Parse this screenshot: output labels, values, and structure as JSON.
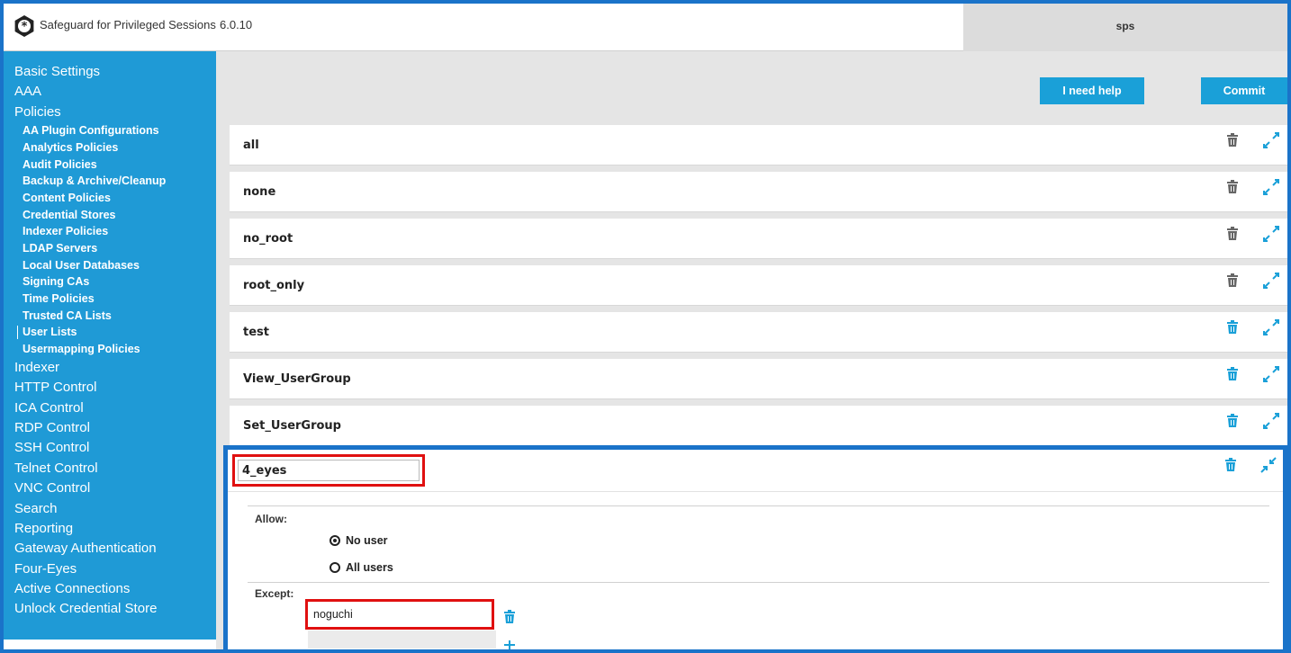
{
  "header": {
    "brand": "Safeguard for Privileged Sessions",
    "version": "6.0.10",
    "host": "sps"
  },
  "sidebar": {
    "items": [
      {
        "label": "Basic Settings",
        "level": "top"
      },
      {
        "label": "AAA",
        "level": "top"
      },
      {
        "label": "Policies",
        "level": "top"
      },
      {
        "label": "AA Plugin Configurations",
        "level": "sub"
      },
      {
        "label": "Analytics Policies",
        "level": "sub"
      },
      {
        "label": "Audit Policies",
        "level": "sub"
      },
      {
        "label": "Backup & Archive/Cleanup",
        "level": "sub"
      },
      {
        "label": "Content Policies",
        "level": "sub"
      },
      {
        "label": "Credential Stores",
        "level": "sub"
      },
      {
        "label": "Indexer Policies",
        "level": "sub"
      },
      {
        "label": "LDAP Servers",
        "level": "sub"
      },
      {
        "label": "Local User Databases",
        "level": "sub"
      },
      {
        "label": "Signing CAs",
        "level": "sub"
      },
      {
        "label": "Time Policies",
        "level": "sub"
      },
      {
        "label": "Trusted CA Lists",
        "level": "sub"
      },
      {
        "label": "User Lists",
        "level": "sub",
        "active": true
      },
      {
        "label": "Usermapping Policies",
        "level": "sub"
      },
      {
        "label": "Indexer",
        "level": "top"
      },
      {
        "label": "HTTP Control",
        "level": "top"
      },
      {
        "label": "ICA Control",
        "level": "top"
      },
      {
        "label": "RDP Control",
        "level": "top"
      },
      {
        "label": "SSH Control",
        "level": "top"
      },
      {
        "label": "Telnet Control",
        "level": "top"
      },
      {
        "label": "VNC Control",
        "level": "top"
      },
      {
        "label": "Search",
        "level": "top"
      },
      {
        "label": "Reporting",
        "level": "top"
      },
      {
        "label": "Gateway Authentication",
        "level": "top"
      },
      {
        "label": "Four-Eyes",
        "level": "top"
      },
      {
        "label": "Active Connections",
        "level": "top"
      },
      {
        "label": "Unlock Credential Store",
        "level": "top"
      }
    ]
  },
  "toolbar": {
    "help_label": "I need help",
    "commit_label": "Commit"
  },
  "user_lists": [
    {
      "name": "all",
      "deletable": false
    },
    {
      "name": "none",
      "deletable": false
    },
    {
      "name": "no_root",
      "deletable": false
    },
    {
      "name": "root_only",
      "deletable": false
    },
    {
      "name": "test",
      "deletable": true
    },
    {
      "name": "View_UserGroup",
      "deletable": true
    },
    {
      "name": "Set_UserGroup",
      "deletable": true
    }
  ],
  "expanded": {
    "name_value": "4_eyes",
    "allow_label": "Allow:",
    "allow_options": [
      {
        "label": "No user",
        "checked": true
      },
      {
        "label": "All users",
        "checked": false
      }
    ],
    "except_label": "Except:",
    "except_value": "noguchi"
  },
  "colors": {
    "accent": "#1aa0d8",
    "sidebar": "#1f9ad6",
    "highlight": "#e01010",
    "frame": "#1a73c9"
  }
}
